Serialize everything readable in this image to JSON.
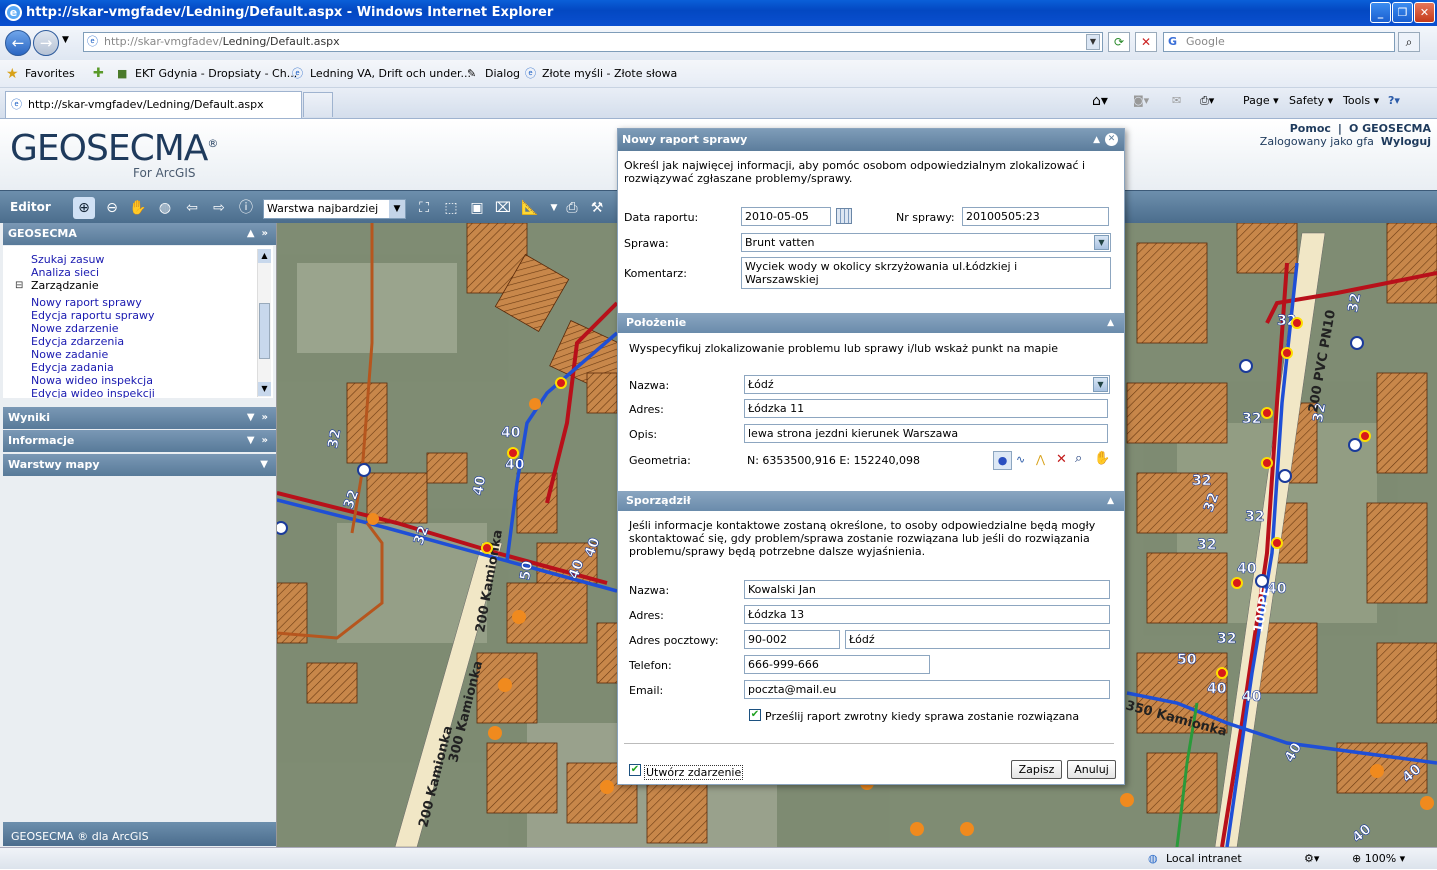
{
  "window": {
    "title": "http://skar-vmgfadev/Ledning/Default.aspx - Windows Internet Explorer"
  },
  "browser": {
    "url_host": "http://skar-vmgfadev/",
    "url_path": "Ledning/Default.aspx",
    "search_placeholder": "Google",
    "favorites_label": "Favorites",
    "favorites": [
      "EKT Gdynia - Dropsiaty - Ch...",
      "Ledning VA, Drift och under...",
      "Dialog",
      "Złote myśli - Złote słowa"
    ],
    "tab_title": "http://skar-vmgfadev/Ledning/Default.aspx",
    "commands": {
      "page": "Page",
      "safety": "Safety",
      "tools": "Tools"
    },
    "status_zone": "Local intranet",
    "zoom": "100%"
  },
  "app": {
    "logo": "GEOSECMA",
    "logo_reg": "®",
    "logo_sub": "For ArcGIS",
    "help_link": "Pomoc",
    "separator": "|",
    "about_link": "O GEOSECMA",
    "logged_as": "Zalogowany jako gfa",
    "logout": "Wyloguj",
    "toolbar_label": "Editor",
    "layer_select": "Warstwa najbardziej",
    "footer": "GEOSECMA ® dla ArcGIS"
  },
  "sidebar": {
    "geosecma_header": "GEOSECMA",
    "items": [
      "Szukaj zasuw",
      "Analiza sieci"
    ],
    "group": "Zarządzanie",
    "group_items": [
      "Nowy raport sprawy",
      "Edycja raportu sprawy",
      "Nowe zdarzenie",
      "Edycja zdarzenia",
      "Nowe zadanie",
      "Edycja zadania",
      "Nowa wideo inspekcja",
      "Edycja wideo inspekcji"
    ],
    "panels": [
      "Wyniki",
      "Informacje",
      "Warstwy mapy"
    ]
  },
  "dialog": {
    "title": "Nowy raport sprawy",
    "intro": "Określ jak najwięcej informacji, aby pomóc osobom odpowiedzialnym zlokalizować i rozwiązywać zgłaszane problemy/sprawy.",
    "date_label": "Data raportu:",
    "date_value": "2010-05-05",
    "case_no_label": "Nr sprawy:",
    "case_no_value": "20100505:23",
    "case_label": "Sprawa:",
    "case_value": "Brunt vatten",
    "comment_label": "Komentarz:",
    "comment_value": "Wyciek wody w okolicy skrzyżowania ul.Łódzkiej i Warszawskiej",
    "location_header": "Położenie",
    "location_intro": "Wyspecyfikuj zlokalizowanie problemu lub sprawy i/lub wskaż punkt na mapie",
    "loc_name_label": "Nazwa:",
    "loc_name_value": "Łódź",
    "loc_addr_label": "Adres:",
    "loc_addr_value": "Łódzka 11",
    "loc_desc_label": "Opis:",
    "loc_desc_value": "lewa strona jezdni kierunek Warszawa",
    "geom_label": "Geometria:",
    "geom_value": "N: 6353500,916 E: 152240,098",
    "author_header": "Sporządził",
    "author_intro": "Jeśli informacje kontaktowe zostaną określone, to osoby odpowiedzialne będą mogły skontaktować się, gdy problem/sprawa zostanie rozwiązana lub jeśli do rozwiązania problemu/sprawy będą potrzebne dalsze wyjaśnienia.",
    "a_name_label": "Nazwa:",
    "a_name_value": "Kowalski Jan",
    "a_addr_label": "Adres:",
    "a_addr_value": "Łódzka 13",
    "a_post_label": "Adres pocztowy:",
    "a_post_code": "90-002",
    "a_post_city": "Łódź",
    "a_phone_label": "Telefon:",
    "a_phone_value": "666-999-666",
    "a_email_label": "Email:",
    "a_email_value": "poczta@mail.eu",
    "feedback_label": "Prześlij raport zwrotny kiedy sprawa zostanie rozwiązana",
    "create_event_label": "Utwórz zdarzenie",
    "save": "Zapisz",
    "cancel": "Anuluj"
  },
  "map": {
    "labels": [
      "200 Kamionka",
      "300 Kamionka",
      "200 Kamionka",
      "350 Kamionka",
      "200 PVC PN10",
      "100PE",
      "32",
      "40",
      "50"
    ]
  },
  "colors": {
    "water_main": "#1f4fd6",
    "sewer": "#b8101a",
    "service": "#b6561e",
    "node": "#f08a1e",
    "parcel": "#c8874a",
    "dialog_header": "#6a8bab"
  }
}
